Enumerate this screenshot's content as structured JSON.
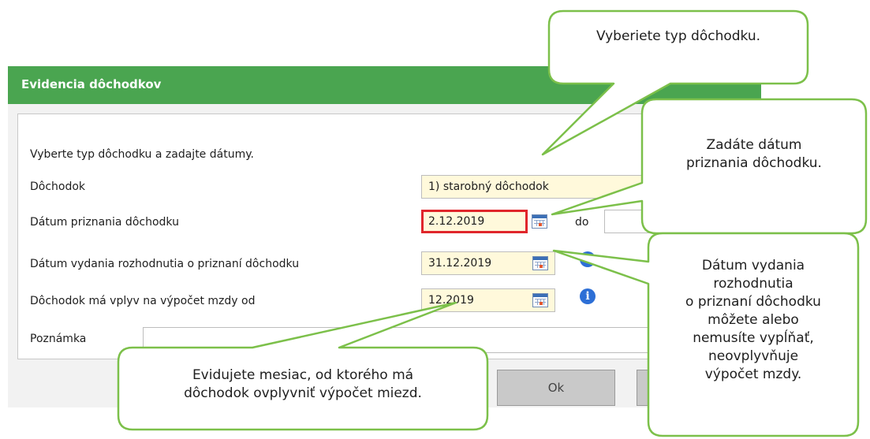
{
  "dialog": {
    "title": "Evidencia dôchodkov",
    "instruction": "Vyberte typ dôchodku a zadajte dátumy.",
    "rows": {
      "pension": {
        "label": "Dôchodok",
        "value": "1) starobný dôchodok"
      },
      "grant_date": {
        "label": "Dátum priznania dôchodku",
        "value": "2.12.2019",
        "to_label": "do"
      },
      "decision_date": {
        "label": "Dátum vydania rozhodnutia o priznaní dôchodku",
        "value": "31.12.2019"
      },
      "influence_from": {
        "label": "Dôchodok má vplyv na výpočet mzdy od",
        "value": "12.2019"
      },
      "note": {
        "label": "Poznámka",
        "value": ""
      }
    },
    "buttons": {
      "ok": "Ok"
    }
  },
  "callouts": {
    "type": "Vyberiete typ dôchodku.",
    "grant_date": [
      "Zadáte dátum",
      "priznania dôchodku."
    ],
    "decision_date": [
      "Dátum vydania",
      "rozhodnutia",
      "o priznaní dôchodku",
      "môžete alebo",
      "nemusíte vypĺňať,",
      "neovplyvňuje",
      "výpočet mzdy."
    ],
    "influence": [
      "Evidujete mesiac, od ktorého má",
      "dôchodok ovplyvniť výpočet miezd."
    ]
  },
  "colors": {
    "titlebar": "#4aa550",
    "callout_border": "#7cc04a",
    "field_bg": "#fff9db",
    "highlight": "#e0262b",
    "info": "#2d6fd6"
  },
  "icons": [
    "calendar-icon",
    "info-icon"
  ]
}
